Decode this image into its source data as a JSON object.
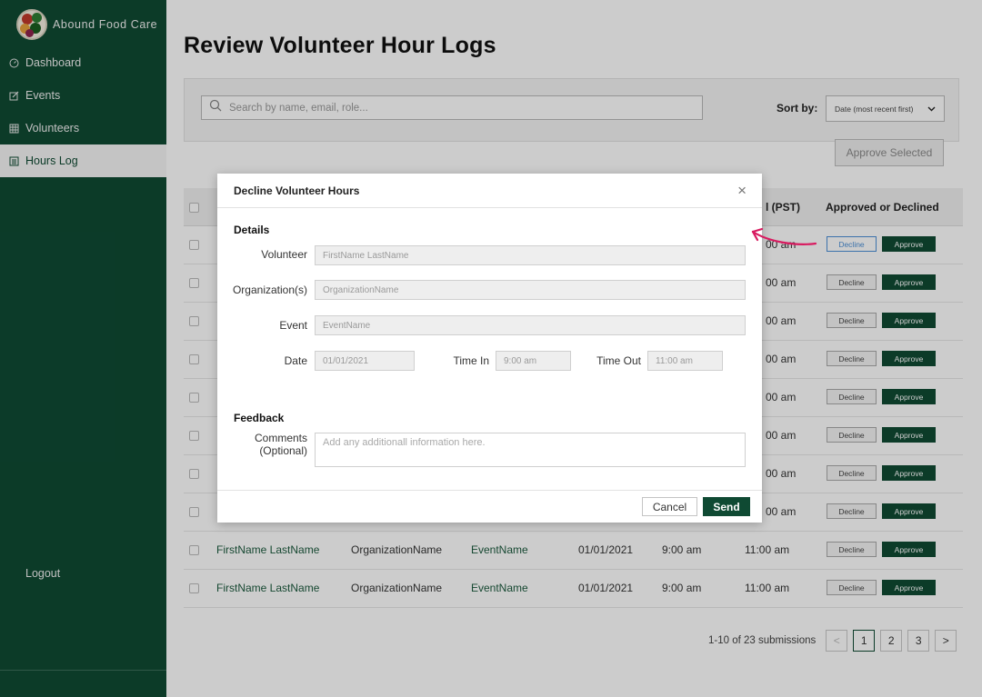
{
  "app": {
    "name": "Abound Food Care"
  },
  "sidebar": {
    "items": [
      {
        "label": "Dashboard",
        "icon": "dashboard-icon"
      },
      {
        "label": "Events",
        "icon": "edit-icon"
      },
      {
        "label": "Volunteers",
        "icon": "grid-icon"
      },
      {
        "label": "Hours Log",
        "icon": "list-icon",
        "active": true
      }
    ],
    "logout_label": "Logout"
  },
  "page": {
    "title": "Review Volunteer Hour Logs"
  },
  "filters": {
    "search_placeholder": "Search by name, email, role...",
    "sort_label": "Sort by:",
    "sort_value": "Date (most recent first)",
    "approve_selected_label": "Approve Selected"
  },
  "table": {
    "visible_headers": {
      "time_out": "l (PST)",
      "status": "Approved or Declined"
    },
    "rows": [
      {
        "time_out_partial": "00 am",
        "decline": "Decline",
        "approve": "Approve"
      },
      {
        "time_out_partial": "00 am",
        "decline": "Decline",
        "approve": "Approve"
      },
      {
        "time_out_partial": "00 am",
        "decline": "Decline",
        "approve": "Approve"
      },
      {
        "time_out_partial": "00 am",
        "decline": "Decline",
        "approve": "Approve"
      },
      {
        "time_out_partial": "00 am",
        "decline": "Decline",
        "approve": "Approve"
      },
      {
        "time_out_partial": "00 am",
        "decline": "Decline",
        "approve": "Approve"
      },
      {
        "time_out_partial": "00 am",
        "decline": "Decline",
        "approve": "Approve"
      },
      {
        "time_out_partial": "00 am",
        "decline": "Decline",
        "approve": "Approve"
      },
      {
        "name": "FirstName LastName",
        "org": "OrganizationName",
        "event": "EventName",
        "date": "01/01/2021",
        "time_in": "9:00 am",
        "time_out": "11:00 am",
        "decline": "Decline",
        "approve": "Approve"
      },
      {
        "name": "FirstName LastName",
        "org": "OrganizationName",
        "event": "EventName",
        "date": "01/01/2021",
        "time_in": "9:00 am",
        "time_out": "11:00 am",
        "decline": "Decline",
        "approve": "Approve"
      }
    ]
  },
  "pagination": {
    "label": "1-10 of 23 submissions",
    "prev": "<",
    "pages": [
      "1",
      "2",
      "3"
    ],
    "current": "1",
    "next": ">"
  },
  "modal": {
    "title": "Decline Volunteer Hours",
    "close": "×",
    "details_heading": "Details",
    "volunteer_label": "Volunteer",
    "volunteer_value": "FirstName LastName",
    "org_label": "Organization(s)",
    "org_value": "OrganizationName",
    "event_label": "Event",
    "event_value": "EventName",
    "date_label": "Date",
    "date_value": "01/01/2021",
    "time_in_label": "Time In",
    "time_in_value": "9:00 am",
    "time_out_label": "Time Out",
    "time_out_value": "11:00 am",
    "feedback_heading": "Feedback",
    "comments_label_1": "Comments",
    "comments_label_2": "(Optional)",
    "comments_placeholder": "Add any additionall information here.",
    "cancel_label": "Cancel",
    "send_label": "Send"
  },
  "colors": {
    "brand": "#0f4a33",
    "annotation": "#d81b60",
    "focus": "#4b8fd6"
  }
}
